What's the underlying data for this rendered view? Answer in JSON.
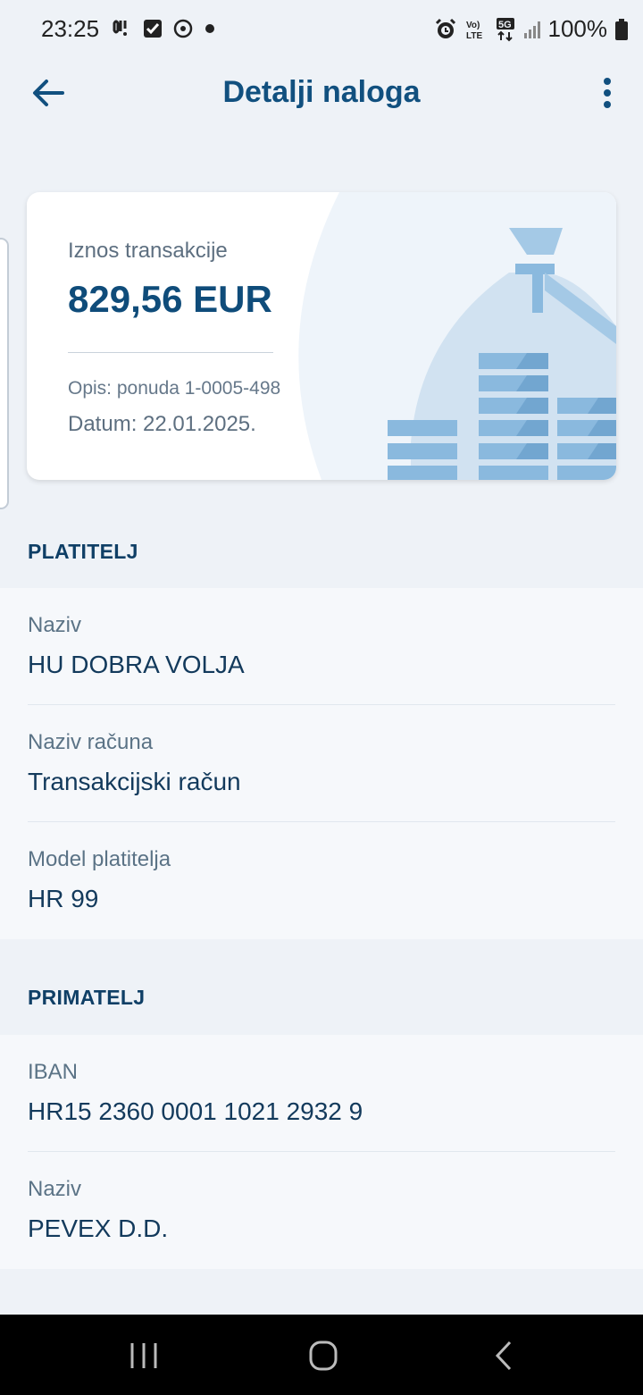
{
  "status_bar": {
    "time": "23:25",
    "battery_text": "100%",
    "icons_left": [
      "notification-icon",
      "checkbox-icon",
      "soccer-icon",
      "dot-icon"
    ],
    "icons_right": [
      "alarm-icon",
      "volte-icon",
      "5g-icon",
      "signal-icon",
      "battery-icon"
    ]
  },
  "app_bar": {
    "title": "Detalji naloga"
  },
  "card": {
    "amount_label": "Iznos transakcije",
    "amount_value": "829,56 EUR",
    "description": "Opis: ponuda 1-0005-498",
    "date": "Datum: 22.01.2025."
  },
  "payer": {
    "title": "PLATITELJ",
    "rows": [
      {
        "label": "Naziv",
        "value": "HU DOBRA VOLJA"
      },
      {
        "label": "Naziv računa",
        "value": "Transakcijski račun"
      },
      {
        "label": "Model platitelja",
        "value": "HR 99"
      }
    ]
  },
  "recipient": {
    "title": "PRIMATELJ",
    "rows": [
      {
        "label": "IBAN",
        "value": "HR15 2360 0001 1021 2932 9"
      },
      {
        "label": "Naziv",
        "value": "PEVEX D.D."
      }
    ]
  },
  "colors": {
    "background": "#eef2f7",
    "primary": "#11507f",
    "illustration": "#8ab9de"
  }
}
